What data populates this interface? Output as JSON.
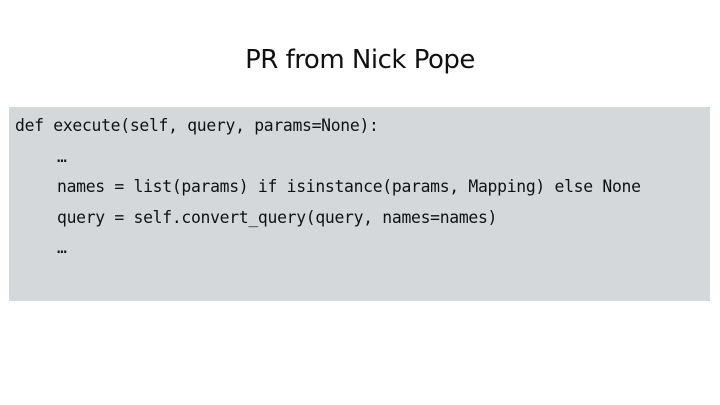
{
  "slide": {
    "title": "PR from Nick Pope",
    "code_lines": [
      "def execute(self, query, params=None):",
      "…",
      "names = list(params) if isinstance(params, Mapping) else None",
      "query = self.convert_query(query, names=names)",
      "…"
    ]
  },
  "colors": {
    "background": "#ffffff",
    "code_background": "#d5d8db",
    "text": "#111111"
  }
}
